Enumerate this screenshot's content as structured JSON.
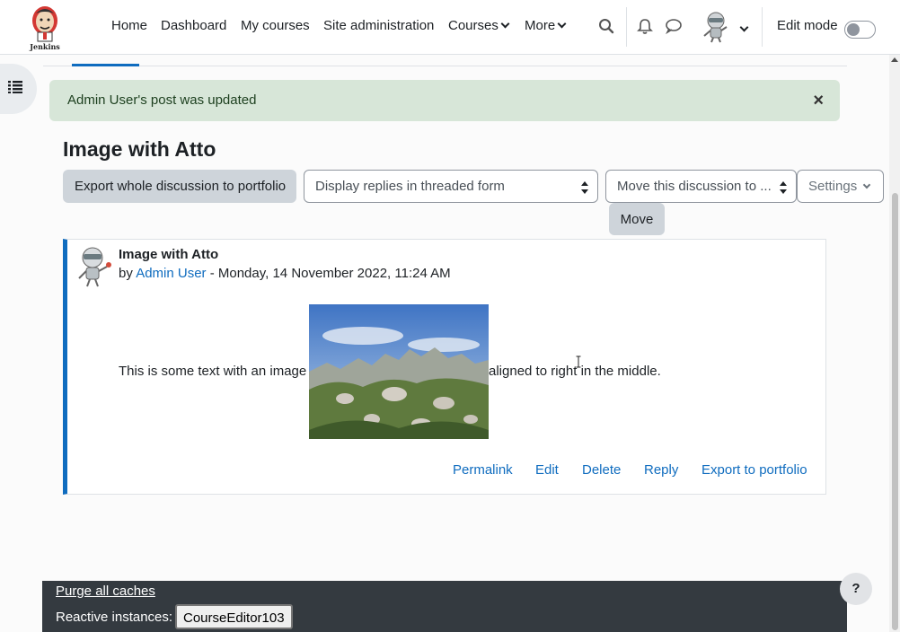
{
  "nav": {
    "logo_text": "Jenkins",
    "items": [
      {
        "label": "Home"
      },
      {
        "label": "Dashboard"
      },
      {
        "label": "My courses"
      },
      {
        "label": "Site administration"
      },
      {
        "label": "Courses"
      },
      {
        "label": "More"
      }
    ],
    "edit_mode_label": "Edit mode"
  },
  "alert": {
    "message": "Admin User's post was updated",
    "close": "×"
  },
  "page": {
    "title": "Image with Atto",
    "export_button": "Export whole discussion to portfolio",
    "display_select": "Display replies in threaded form",
    "move_select": "Move this discussion to ...",
    "move_button": "Move",
    "settings_button": "Settings"
  },
  "post": {
    "subject": "Image with Atto",
    "by_prefix": "by",
    "author": "Admin User",
    "date": " - Monday, 14 November 2022, 11:24 AM",
    "text_before": "This is some text with an image",
    "text_after": "aligned to right in the middle.",
    "actions": [
      "Permalink",
      "Edit",
      "Delete",
      "Reply",
      "Export to portfolio"
    ]
  },
  "footer": {
    "purge": "Purge all caches",
    "reactive_label": "Reactive instances:",
    "reactive_button": "CourseEditor103"
  },
  "help": "?",
  "colors": {
    "primary": "#0f6cbf",
    "alert_bg": "#d7e6d8",
    "footer_bg": "#343a40"
  }
}
